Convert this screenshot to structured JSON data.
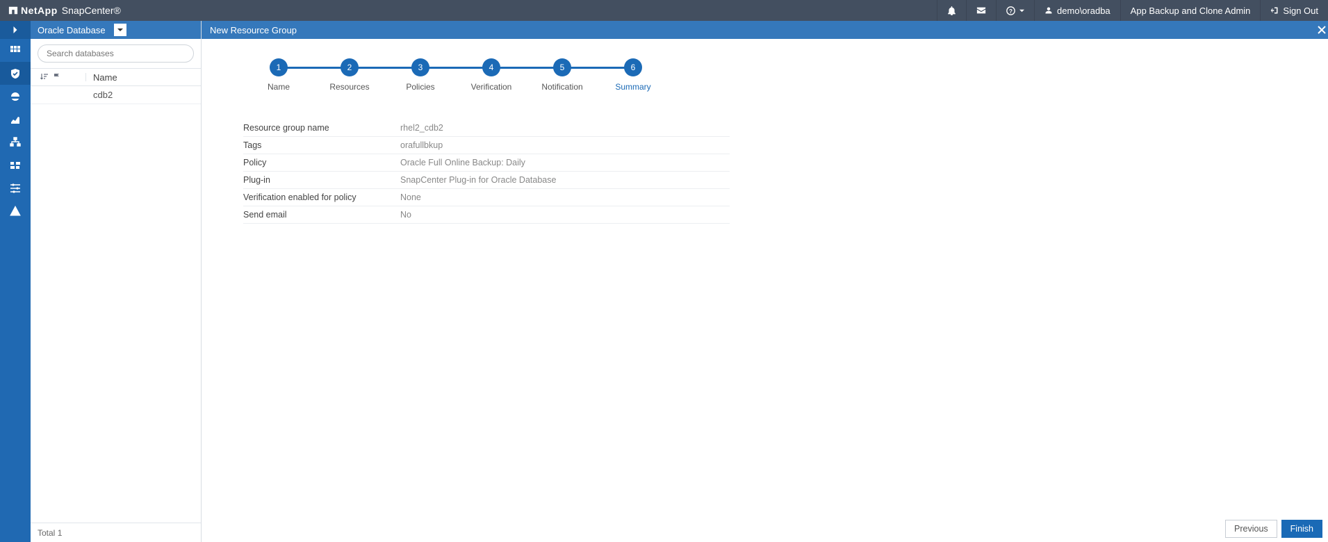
{
  "header": {
    "company": "NetApp",
    "product": "SnapCenter®",
    "user": "demo\\oradba",
    "role": "App Backup and Clone Admin",
    "signout": "Sign Out"
  },
  "pane": {
    "selector": "Oracle Database",
    "search_placeholder": "Search databases",
    "col_name": "Name",
    "rows": [
      "cdb2"
    ],
    "total_label": "Total",
    "total": 1
  },
  "content": {
    "title": "New Resource Group",
    "steps": [
      {
        "n": "1",
        "label": "Name"
      },
      {
        "n": "2",
        "label": "Resources"
      },
      {
        "n": "3",
        "label": "Policies"
      },
      {
        "n": "4",
        "label": "Verification"
      },
      {
        "n": "5",
        "label": "Notification"
      },
      {
        "n": "6",
        "label": "Summary"
      }
    ],
    "active_step": 6,
    "summary": [
      {
        "k": "Resource group name",
        "v": "rhel2_cdb2"
      },
      {
        "k": "Tags",
        "v": "orafullbkup"
      },
      {
        "k": "Policy",
        "v": "Oracle Full Online Backup: Daily"
      },
      {
        "k": "Plug-in",
        "v": "SnapCenter Plug-in for Oracle Database"
      },
      {
        "k": "Verification enabled for policy",
        "v": "None"
      },
      {
        "k": "Send email",
        "v": "No"
      }
    ],
    "buttons": {
      "prev": "Previous",
      "finish": "Finish"
    }
  }
}
